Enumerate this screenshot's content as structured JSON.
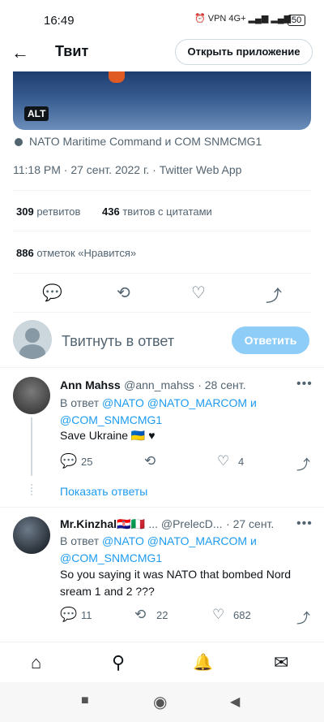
{
  "status": {
    "time": "16:49",
    "battery": "50",
    "icons_text": "⏰ VPN 4G+ ▂▄▆ ▂▄▆"
  },
  "header": {
    "title": "Твит",
    "open_app": "Открыть приложение"
  },
  "media": {
    "alt_badge": "ALT"
  },
  "tweet": {
    "tagged": "NATO Maritime Command и COM SNMCMG1",
    "meta": "11:18 PM · 27 сент. 2022 г. · Twitter Web App",
    "retweets_count": "309",
    "retweets_label": "ретвитов",
    "quotes_count": "436",
    "quotes_label": "твитов с цитатами",
    "likes_count": "886",
    "likes_label": "отметок «Нравится»"
  },
  "compose": {
    "placeholder": "Твитнуть в ответ",
    "button": "Ответить"
  },
  "replies": [
    {
      "name": "Ann Mahss",
      "handle": "@ann_mahss",
      "date": "· 28 сент.",
      "reply_to_prefix": "В ответ",
      "reply_to_line1": "@NATO @NATO_MARCOM и",
      "reply_to_line2": "@COM_SNMCMG1",
      "text": "Save Ukraine 🇺🇦 ♥",
      "replies": "25",
      "retweets": "",
      "likes": "4",
      "show_replies": "Показать ответы"
    },
    {
      "name": "Mr.Kinzhal🇭🇷🇮🇹",
      "handle": "... @PrelecD...",
      "date": "· 27 сент.",
      "reply_to_prefix": "В ответ",
      "reply_to_line1": "@NATO @NATO_MARCOM и",
      "reply_to_line2": "@COM_SNMCMG1",
      "text_line1": "So you saying it was NATO that bombed Nord",
      "text_line2": "sream 1 and 2 ???",
      "replies": "11",
      "retweets": "22",
      "likes": "682"
    }
  ],
  "icons": {
    "back": "←",
    "reply": "💬",
    "retweet": "⟲",
    "like": "♡",
    "share": "⤴",
    "more": "•••",
    "nav_home": "⌂",
    "nav_search": "⚲",
    "nav_notifications": "🔔",
    "nav_messages": "✉",
    "sys_recents": "■",
    "sys_home": "◉",
    "sys_back": "◀"
  }
}
